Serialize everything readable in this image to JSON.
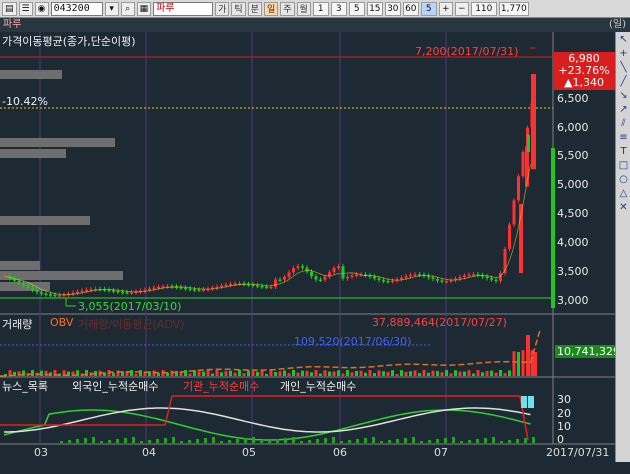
{
  "toolbar": {
    "code": "043200",
    "name": "파루",
    "period_tabs": [
      "가",
      "틱",
      "분",
      "일",
      "주",
      "월"
    ],
    "numbers": [
      "1",
      "3",
      "5",
      "15",
      "30",
      "60"
    ],
    "interval": "5",
    "bars_count": "110",
    "bars_total": "1,770"
  },
  "subbar": {
    "title": "파루",
    "right_label": "(일)"
  },
  "price_panel": {
    "title": "가격이동평균(종가,단순이평)",
    "percent_label": "-10.42%",
    "high_label": "7,200(2017/07/31)",
    "low_label": "3,055(2017/03/10)",
    "current_price": "6,980",
    "current_change_pct": "+23.76%",
    "current_change": "▲1,340",
    "axis": [
      "6,500",
      "6,000",
      "5,500",
      "5,000",
      "4,500",
      "4,000",
      "3,500",
      "3,000"
    ]
  },
  "volume_panel": {
    "title": "거래량",
    "obv_label": "OBV",
    "obv_faded": "거래량/이동평균(ADV)",
    "high_label": "37,889,464(2017/07/27)",
    "mid_label": "109,520(2017/06/30)",
    "obv_value": "10,741,329"
  },
  "flow_panel": {
    "labels": [
      "뉴스_목록",
      "외국인_누적순매수",
      "기관_누적순매수",
      "개인_누적순매수"
    ],
    "axis": [
      "30",
      "20",
      "10",
      "0"
    ]
  },
  "dates": [
    "03",
    "04",
    "05",
    "06",
    "07",
    "2017/07/31"
  ],
  "colors": {
    "up": "#ff3030",
    "down": "#1ec81e",
    "bg": "#1e2a33",
    "accent": "#d81e1e"
  }
}
